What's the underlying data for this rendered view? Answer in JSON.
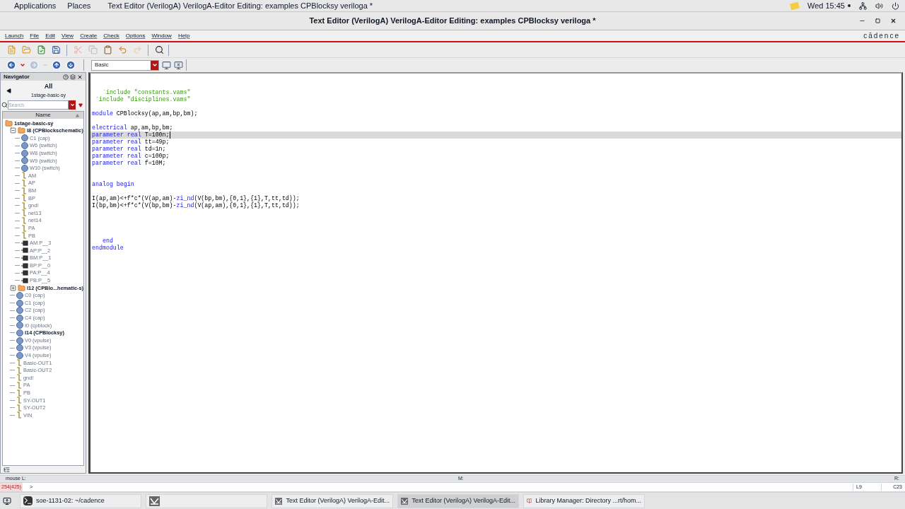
{
  "top_bar": {
    "menus": [
      "Applications",
      "Places"
    ],
    "app_title": "Text Editor (VerilogA) VerilogA-Editor Editing: examples CPBlocksy veriloga *",
    "clock": "Wed 15:45"
  },
  "window": {
    "title": "Text Editor (VerilogA) VerilogA-Editor Editing: examples CPBlocksy veriloga *"
  },
  "menu_bar": {
    "items": [
      "Launch",
      "File",
      "Edit",
      "View",
      "Create",
      "Check",
      "Options",
      "Window",
      "Help"
    ],
    "logo": "cādence"
  },
  "toolbar_1": [
    {
      "kind": "new",
      "disabled": false
    },
    {
      "kind": "open",
      "disabled": false
    },
    {
      "kind": "check",
      "disabled": false
    },
    {
      "kind": "save",
      "disabled": false
    },
    {
      "kind": "cut",
      "disabled": true
    },
    {
      "kind": "copy",
      "disabled": true
    },
    {
      "kind": "paste",
      "disabled": false
    },
    {
      "kind": "undo",
      "disabled": false
    },
    {
      "kind": "redo",
      "disabled": true
    },
    {
      "kind": "find",
      "disabled": false
    }
  ],
  "toolbar_2": {
    "nav": [
      {
        "kind": "back",
        "disabled": false
      },
      {
        "kind": "forward",
        "disabled": true
      },
      {
        "kind": "up",
        "disabled": false
      },
      {
        "kind": "down",
        "disabled": false
      }
    ],
    "workspace": "Basic"
  },
  "navigator": {
    "title": "Navigator",
    "scope": "All",
    "design": "1stage-basic-sy",
    "search_placeholder": "Search",
    "column": "Name",
    "tree": [
      {
        "label": "1stage-basic-sy",
        "kind": "folder",
        "bold": true,
        "children": [
          {
            "label": "I8 (CPBlockschematic)",
            "kind": "folder",
            "bold": true,
            "expanded": true,
            "children": [
              {
                "label": "C1 (cap)",
                "kind": "inst",
                "bold": false
              },
              {
                "label": "W6 (switch)",
                "kind": "inst",
                "bold": false
              },
              {
                "label": "W8 (switch)",
                "kind": "inst",
                "bold": false
              },
              {
                "label": "W9 (switch)",
                "kind": "inst",
                "bold": false
              },
              {
                "label": "W10 (switch)",
                "kind": "inst",
                "bold": false
              },
              {
                "label": "AM",
                "kind": "net",
                "bold": false
              },
              {
                "label": "AP",
                "kind": "net",
                "bold": false
              },
              {
                "label": "BM",
                "kind": "net",
                "bold": false
              },
              {
                "label": "BP",
                "kind": "net",
                "bold": false
              },
              {
                "label": "gnd!",
                "kind": "net",
                "bold": false
              },
              {
                "label": "net13",
                "kind": "net",
                "bold": false
              },
              {
                "label": "net14",
                "kind": "net",
                "bold": false
              },
              {
                "label": "PA",
                "kind": "net",
                "bold": false
              },
              {
                "label": "PB",
                "kind": "net",
                "bold": false
              },
              {
                "label": "AM:P__3",
                "kind": "term",
                "bold": false
              },
              {
                "label": "AP:P__2",
                "kind": "term",
                "bold": false
              },
              {
                "label": "BM:P__1",
                "kind": "term",
                "bold": false
              },
              {
                "label": "BP:P__0",
                "kind": "term",
                "bold": false
              },
              {
                "label": "PA:P__4",
                "kind": "term",
                "bold": false
              },
              {
                "label": "PB:P__5",
                "kind": "term",
                "bold": false
              }
            ]
          },
          {
            "label": "I12 (CPBlo...hematic-s)",
            "kind": "folder",
            "bold": true,
            "expanded": false
          },
          {
            "label": "C0 (cap)",
            "kind": "inst",
            "bold": false
          },
          {
            "label": "C1 (cap)",
            "kind": "inst",
            "bold": false
          },
          {
            "label": "C2 (cap)",
            "kind": "inst",
            "bold": false
          },
          {
            "label": "C4 (cap)",
            "kind": "inst",
            "bold": false
          },
          {
            "label": "I0 (cpblock)",
            "kind": "inst",
            "bold": false
          },
          {
            "label": "I14 (CPBlocksy)",
            "kind": "inst",
            "bold": true
          },
          {
            "label": "V0 (vpulse)",
            "kind": "inst",
            "bold": false
          },
          {
            "label": "V3 (vpulse)",
            "kind": "inst",
            "bold": false
          },
          {
            "label": "V4 (vpulse)",
            "kind": "inst",
            "bold": false
          },
          {
            "label": "Basic-OUT1",
            "kind": "net",
            "bold": false
          },
          {
            "label": "Basic-OUT2",
            "kind": "net",
            "bold": false
          },
          {
            "label": "gnd!",
            "kind": "net",
            "bold": false
          },
          {
            "label": "PA",
            "kind": "net",
            "bold": false
          },
          {
            "label": "PB",
            "kind": "net",
            "bold": false
          },
          {
            "label": "SY-OUT1",
            "kind": "net",
            "bold": false
          },
          {
            "label": "SY-OUT2",
            "kind": "net",
            "bold": false
          },
          {
            "label": "VIN",
            "kind": "net",
            "bold": false
          }
        ]
      }
    ]
  },
  "editor": {
    "lines": [
      {
        "kind": "code",
        "current": false,
        "tokens": [
          {
            "t": "   `include \"constants.vams\"",
            "kind": "string"
          }
        ]
      },
      {
        "kind": "code",
        "current": false,
        "tokens": [
          {
            "t": " `include \"disciplines.vams\"",
            "kind": "string"
          }
        ]
      },
      {
        "kind": "blank"
      },
      {
        "kind": "code",
        "current": false,
        "tokens": [
          {
            "t": "module",
            "kind": "keyword"
          },
          {
            "t": " CPBlocksy(ap,am,bp,bm);",
            "kind": "plain"
          }
        ]
      },
      {
        "kind": "blank"
      },
      {
        "kind": "code",
        "current": false,
        "tokens": [
          {
            "t": "electrical",
            "kind": "keyword"
          },
          {
            "t": " ap,am,bp,bm;",
            "kind": "plain"
          }
        ]
      },
      {
        "kind": "code",
        "current": true,
        "tokens": [
          {
            "t": "parameter real",
            "kind": "keyword"
          },
          {
            "t": " T=100n;",
            "kind": "plain"
          }
        ]
      },
      {
        "kind": "code",
        "current": false,
        "tokens": [
          {
            "t": "parameter real",
            "kind": "keyword"
          },
          {
            "t": " tt=49p;",
            "kind": "plain"
          }
        ]
      },
      {
        "kind": "code",
        "current": false,
        "tokens": [
          {
            "t": "parameter real",
            "kind": "keyword"
          },
          {
            "t": " td=1n;",
            "kind": "plain"
          }
        ]
      },
      {
        "kind": "code",
        "current": false,
        "tokens": [
          {
            "t": "parameter real",
            "kind": "keyword"
          },
          {
            "t": " c=100p;",
            "kind": "plain"
          }
        ]
      },
      {
        "kind": "code",
        "current": false,
        "tokens": [
          {
            "t": "parameter real",
            "kind": "keyword"
          },
          {
            "t": " f=10M;",
            "kind": "plain"
          }
        ]
      },
      {
        "kind": "blank"
      },
      {
        "kind": "blank"
      },
      {
        "kind": "code",
        "current": false,
        "tokens": [
          {
            "t": "analog begin",
            "kind": "keyword"
          }
        ]
      },
      {
        "kind": "blank"
      },
      {
        "kind": "code",
        "current": false,
        "tokens": [
          {
            "t": "I(ap,am)<+f*c*(V(ap,am)-",
            "kind": "plain"
          },
          {
            "t": "zi_nd",
            "kind": "function"
          },
          {
            "t": "(V(bp,bm),{0,1},{1},T,tt,td));",
            "kind": "plain"
          }
        ]
      },
      {
        "kind": "code",
        "current": false,
        "tokens": [
          {
            "t": "I(bp,bm)<+f*c*(V(bp,bm)-",
            "kind": "plain"
          },
          {
            "t": "zi_nd",
            "kind": "function"
          },
          {
            "t": "(V(ap,am),{0,1},{1},T,tt,td));",
            "kind": "plain"
          }
        ]
      },
      {
        "kind": "blank"
      },
      {
        "kind": "blank"
      },
      {
        "kind": "blank"
      },
      {
        "kind": "blank"
      },
      {
        "kind": "code",
        "current": false,
        "tokens": [
          {
            "t": "   end",
            "kind": "keyword"
          }
        ]
      },
      {
        "kind": "code",
        "current": false,
        "tokens": [
          {
            "t": "endmodule",
            "kind": "keyword"
          }
        ]
      }
    ]
  },
  "mouse_status": {
    "left": "mouse L:",
    "middle": "M:",
    "right": "R:"
  },
  "command_line": {
    "counter": "254(425)",
    "prompt": ">",
    "line": "L9",
    "column": "C23"
  },
  "taskbar": [
    {
      "kind": "terminal",
      "label": "soe-1131-02: ~/cadence",
      "selected": false
    },
    {
      "kind": "cadence",
      "selected": false
    },
    {
      "kind": "cadence",
      "label": "Text Editor (VerilogA) VerilogA-Edit...",
      "selected": false
    },
    {
      "kind": "cadence",
      "label": "Text Editor (VerilogA) VerilogA-Edit...",
      "selected": true
    },
    {
      "kind": "book",
      "label": "Library Manager: Directory ...rt/hom...",
      "selected": false
    }
  ]
}
